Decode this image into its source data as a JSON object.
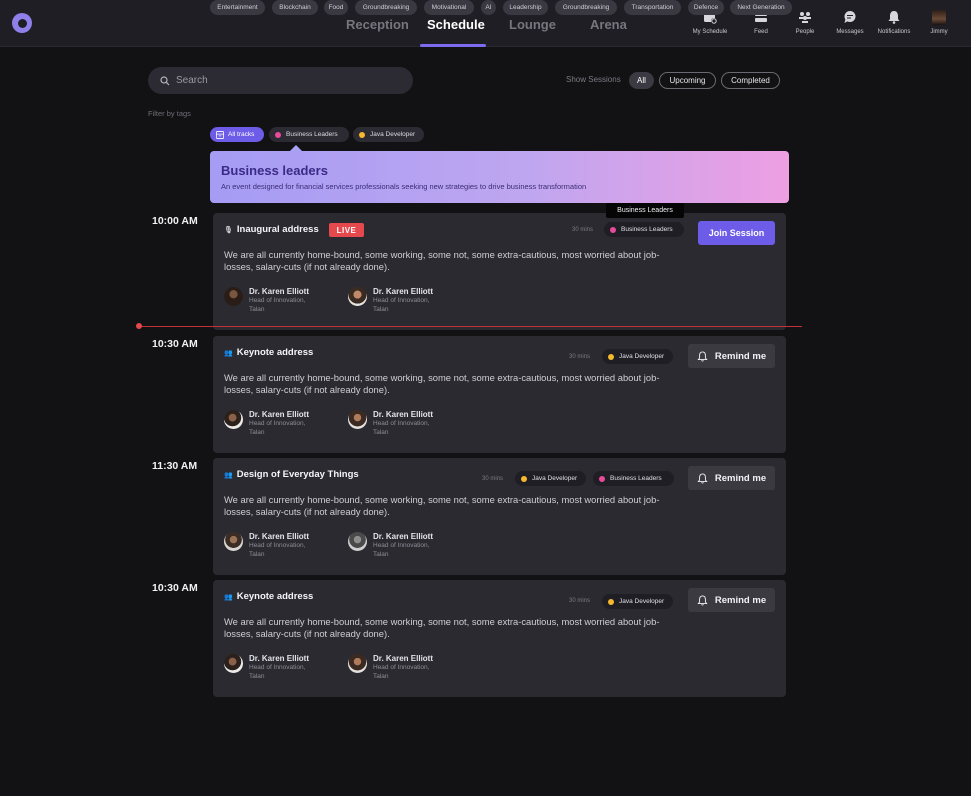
{
  "nav": {
    "tabs": [
      {
        "label": "Reception"
      },
      {
        "label": "Schedule"
      },
      {
        "label": "Lounge"
      },
      {
        "label": "Arena"
      }
    ],
    "icons": [
      {
        "label": "My Schedule",
        "icon": "calendar-icon"
      },
      {
        "label": "Feed",
        "icon": "feed-icon"
      },
      {
        "label": "People",
        "icon": "people-icon"
      },
      {
        "label": "Messages",
        "icon": "chat-icon"
      },
      {
        "label": "Notifications",
        "icon": "bell-icon"
      },
      {
        "label": "Jimmy",
        "icon": "user-avatar"
      }
    ]
  },
  "search": {
    "placeholder": "Search"
  },
  "sessions": {
    "label": "Show Sessions",
    "options": [
      "All",
      "Upcoming",
      "Completed"
    ],
    "selected": "All"
  },
  "filters": {
    "label": "Filter by tags",
    "tags": [
      "Entertainment",
      "Blockchain",
      "Food",
      "Groundbreaking",
      "Motivational",
      "AI",
      "Leadership",
      "Groundbreaking",
      "Transportation",
      "Defence",
      "Next Generation"
    ],
    "tracks": [
      {
        "label": "All tracks",
        "color": "#6c5ce7"
      },
      {
        "label": "Business Leaders",
        "color": "#e84a9c"
      },
      {
        "label": "Java Developer",
        "color": "#f5b82e"
      }
    ]
  },
  "banner": {
    "title": "Business leaders",
    "description": "An event designed for financial services professionals seeking new strategies to drive business transformation"
  },
  "tooltip": "Business Leaders",
  "sessions_list": [
    {
      "time": "10:00 AM",
      "title": "Inaugural address",
      "live": "LIVE",
      "duration": "30 mins",
      "tracks": [
        "Business Leaders"
      ],
      "description": "We are all currently home-bound, some working, some not, some extra-cautious, most worried about job-losses, salary-cuts (if not already done).",
      "action": "Join Session",
      "speakers": [
        {
          "name": "Dr. Karen Elliott",
          "role1": "Head of Innovation,",
          "role2": "Talan"
        },
        {
          "name": "Dr. Karen Elliott",
          "role1": "Head of Innovation,",
          "role2": "Talan"
        }
      ]
    },
    {
      "time": "10:30 AM",
      "title": "Keynote address",
      "duration": "30 mins",
      "tracks": [
        "Java Developer"
      ],
      "description": "We are all currently home-bound, some working, some not, some extra-cautious, most worried about job-losses, salary-cuts (if not already done).",
      "action": "Remind me",
      "speakers": [
        {
          "name": "Dr. Karen Elliott",
          "role1": "Head of Innovation,",
          "role2": "Talan"
        },
        {
          "name": "Dr. Karen Elliott",
          "role1": "Head of Innovation,",
          "role2": "Talan"
        }
      ]
    },
    {
      "time": "11:30 AM",
      "title": "Design of Everyday Things",
      "duration": "30 mins",
      "tracks": [
        "Java Developer",
        "Business Leaders"
      ],
      "description": "We are all currently home-bound, some working, some not, some extra-cautious, most worried about job-losses, salary-cuts (if not already done).",
      "action": "Remind me",
      "speakers": [
        {
          "name": "Dr. Karen Elliott",
          "role1": "Head of Innovation,",
          "role2": "Talan"
        },
        {
          "name": "Dr. Karen Elliott",
          "role1": "Head of Innovation,",
          "role2": "Talan"
        }
      ]
    },
    {
      "time": "10:30 AM",
      "title": "Keynote address",
      "duration": "30 mins",
      "tracks": [
        "Java Developer"
      ],
      "description": "We are all currently home-bound, some working, some not, some extra-cautious, most worried about job-losses, salary-cuts (if not already done).",
      "action": "Remind me",
      "speakers": [
        {
          "name": "Dr. Karen Elliott",
          "role1": "Head of Innovation,",
          "role2": "Talan"
        },
        {
          "name": "Dr. Karen Elliott",
          "role1": "Head of Innovation,",
          "role2": "Talan"
        }
      ]
    }
  ],
  "colors": {
    "accent": "#6c5ce7",
    "live": "#e5484d",
    "business_leaders": "#e84a9c",
    "java_developer": "#f5b82e"
  }
}
